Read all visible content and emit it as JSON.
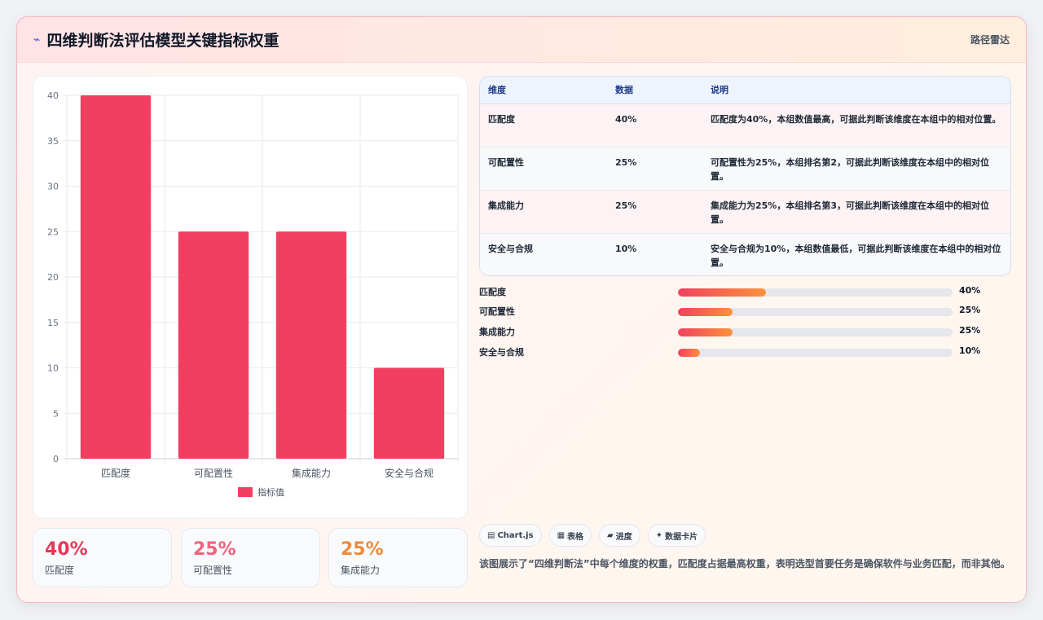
{
  "header": {
    "icon": "pulse-icon",
    "title": "四维判断法评估模型关键指标权重",
    "link": "路径雷达"
  },
  "colors": {
    "bar": "#f23f60",
    "accent_red": "#e8385a",
    "accent_pink": "#f0647e",
    "accent_orange": "#f08a3a"
  },
  "chart_data": {
    "type": "bar",
    "categories": [
      "匹配度",
      "可配置性",
      "集成能力",
      "安全与合规"
    ],
    "series": [
      {
        "name": "指标值",
        "values": [
          40,
          25,
          25,
          10
        ]
      }
    ],
    "ylim": [
      0,
      40
    ],
    "yticks": [
      0,
      5,
      10,
      15,
      20,
      25,
      30,
      35,
      40
    ],
    "grid": true,
    "legend": "bottom"
  },
  "stats": [
    {
      "value": "40%",
      "label": "匹配度",
      "color": "#e8385a"
    },
    {
      "value": "25%",
      "label": "可配置性",
      "color": "#f0647e"
    },
    {
      "value": "25%",
      "label": "集成能力",
      "color": "#f08a3a"
    }
  ],
  "table": {
    "headers": [
      "维度",
      "数据",
      "说明"
    ],
    "rows": [
      [
        "匹配度",
        "40%",
        "匹配度为40%，本组数值最高，可据此判断该维度在本组中的相对位置。"
      ],
      [
        "可配置性",
        "25%",
        "可配置性为25%，本组排名第2，可据此判断该维度在本组中的相对位置。"
      ],
      [
        "集成能力",
        "25%",
        "集成能力为25%，本组排名第3，可据此判断该维度在本组中的相对位置。"
      ],
      [
        "安全与合规",
        "10%",
        "安全与合规为10%，本组数值最低，可据此判断该维度在本组中的相对位置。"
      ]
    ]
  },
  "progress": [
    {
      "label": "匹配度",
      "value_text": "40%",
      "fraction": 0.32
    },
    {
      "label": "可配置性",
      "value_text": "25%",
      "fraction": 0.2
    },
    {
      "label": "集成能力",
      "value_text": "25%",
      "fraction": 0.2
    },
    {
      "label": "安全与合规",
      "value_text": "10%",
      "fraction": 0.08
    }
  ],
  "tags": [
    {
      "icon": "chart-icon",
      "glyph": "▤",
      "label": "Chart.js"
    },
    {
      "icon": "table-icon",
      "glyph": "▦",
      "label": "表格"
    },
    {
      "icon": "progress-icon",
      "glyph": "▰",
      "label": "进度"
    },
    {
      "icon": "card-icon",
      "glyph": "✦",
      "label": "数据卡片"
    }
  ],
  "description": "该图展示了“四维判断法”中每个维度的权重，匹配度占据最高权重，表明选型首要任务是确保软件与业务匹配，而非其他。"
}
